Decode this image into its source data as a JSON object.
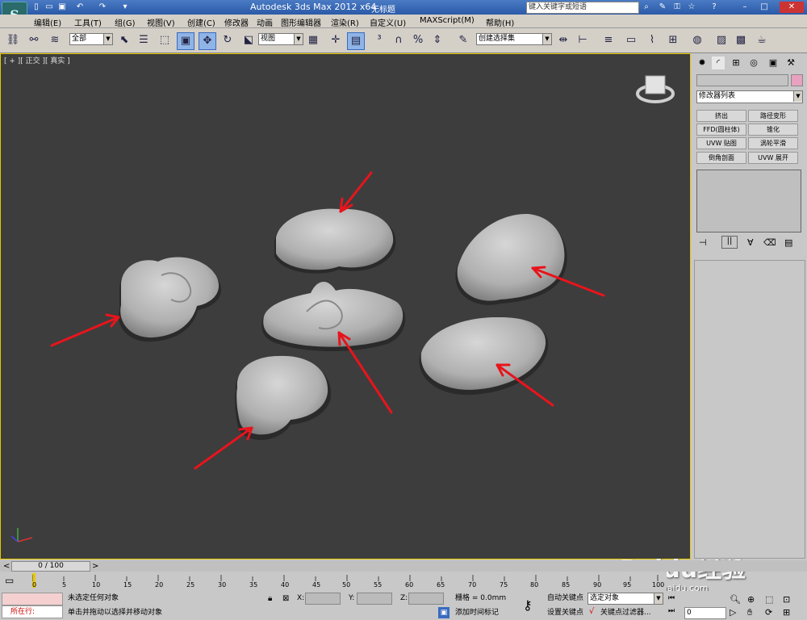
{
  "title_bar": {
    "app_title": "Autodesk 3ds Max  2012 x64",
    "doc_title": "无标题",
    "search_placeholder": "键入关键字或短语",
    "quick_icons": [
      "new-icon",
      "open-icon",
      "save-icon",
      "undo-icon",
      "redo-icon",
      "dropdown-icon"
    ],
    "right_icons": [
      "binoculars-icon",
      "wrench-icon",
      "key-icon",
      "star-icon",
      "help-icon",
      "minimize-icon",
      "maximize-icon",
      "close-icon"
    ]
  },
  "menu": [
    "编辑(E)",
    "工具(T)",
    "组(G)",
    "视图(V)",
    "创建(C)",
    "修改器",
    "动画",
    "图形编辑器",
    "渲染(R)",
    "自定义(U)",
    "MAXScript(M)",
    "帮助(H)"
  ],
  "toolbar": {
    "selection_filter": "全部",
    "ref_coord": "视图",
    "selection_set": "创建选择集"
  },
  "viewport": {
    "label": "[ + ][ 正交 ][ 真实 ]",
    "rocks": 6,
    "arrows": 6,
    "watermark_brand": "Baidu经验",
    "watermark_url": "jingyan.baidu.com"
  },
  "command_panel": {
    "modifier_list": "修改器列表",
    "buttons": [
      "挤出",
      "路径变形",
      "FFD(圆柱体)",
      "锥化",
      "UVW 贴图",
      "涡轮平滑",
      "倒角剖面",
      "UVW 展开"
    ]
  },
  "timeline": {
    "frame_readout": "0 / 100",
    "ticks": [
      "0",
      "5",
      "10",
      "15",
      "20",
      "25",
      "30",
      "35",
      "40",
      "45",
      "50",
      "55",
      "60",
      "65",
      "70",
      "75",
      "80",
      "85",
      "90",
      "95",
      "100"
    ]
  },
  "status": {
    "maxscript": "所在行:",
    "line1": "未选定任何对象",
    "line2": "单击并拖动以选择并移动对象",
    "x_label": "X:",
    "y_label": "Y:",
    "z_label": "Z:",
    "grid": "栅格 = 0.0mm",
    "add_time_tag": "添加时间标记",
    "auto_key": "自动关键点",
    "set_key": "设置关键点",
    "selected": "选定对象",
    "key_filters": "关键点过滤器...",
    "frame": "0"
  },
  "colors": {
    "viewport_bg": "#3d3d3d",
    "viewport_border": "#e8c800",
    "arrow": "#e8141c",
    "rock": "#b9b9b9",
    "title_bar": "#2b5aa8"
  }
}
